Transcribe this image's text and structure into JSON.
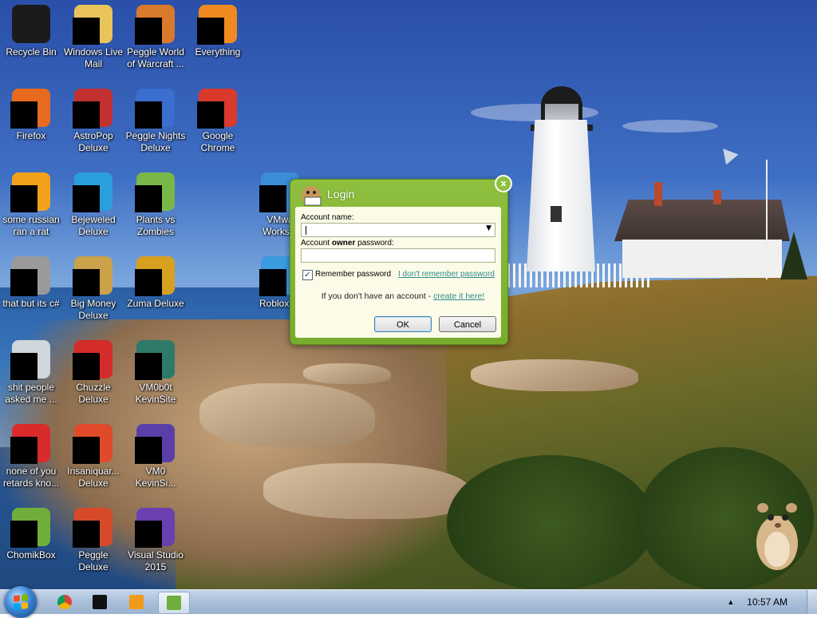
{
  "desktop": {
    "icons": [
      {
        "label": "Recycle Bin",
        "icon": "recycle-bin-icon",
        "color": "#1b1b1b",
        "masked": false
      },
      {
        "label": "Windows Live\nMail",
        "icon": "windows-live-mail-icon",
        "color": "#e8c45a",
        "masked": true
      },
      {
        "label": "Peggle World\nof Warcraft ...",
        "icon": "peggle-wow-icon",
        "color": "#d9792b",
        "masked": true
      },
      {
        "label": "Everything",
        "icon": "everything-search-icon",
        "color": "#f08a20",
        "masked": true
      },
      {
        "label": "Firefox",
        "icon": "firefox-icon",
        "color": "#e86a1f",
        "masked": true
      },
      {
        "label": "AstroPop\nDeluxe",
        "icon": "astropop-icon",
        "color": "#c23030",
        "masked": true
      },
      {
        "label": "Peggle Nights\nDeluxe",
        "icon": "peggle-nights-icon",
        "color": "#3a6fd0",
        "masked": true
      },
      {
        "label": "Google\nChrome",
        "icon": "chrome-icon",
        "color": "#d93a2b",
        "masked": true
      },
      {
        "label": "some russian\nran a rat",
        "icon": "app-icon",
        "color": "#f2a21a",
        "masked": true
      },
      {
        "label": "Bejeweled\nDeluxe",
        "icon": "bejeweled-icon",
        "color": "#2b9fdc",
        "masked": true
      },
      {
        "label": "Plants vs\nZombies",
        "icon": "plants-vs-zombies-icon",
        "color": "#79b848",
        "masked": true
      },
      {
        "label": "VMwa\nWorksta",
        "icon": "vmware-icon",
        "color": "#3b8fd8",
        "masked": true
      },
      {
        "label": "that but its c#",
        "icon": "shortcut-icon",
        "color": "#9a9a9a",
        "masked": true
      },
      {
        "label": "Big Money\nDeluxe",
        "icon": "big-money-icon",
        "color": "#c9a24a",
        "masked": true
      },
      {
        "label": "Zuma Deluxe",
        "icon": "zuma-icon",
        "color": "#d7a020",
        "masked": true
      },
      {
        "label": "Roblox St",
        "icon": "roblox-studio-icon",
        "color": "#3a9be0",
        "masked": true
      },
      {
        "label": "shit people\nasked me ...",
        "icon": "folder-icon",
        "color": "#cfd6dc",
        "masked": true
      },
      {
        "label": "Chuzzle\nDeluxe",
        "icon": "chuzzle-icon",
        "color": "#d42b2b",
        "masked": true
      },
      {
        "label": "VM0b0t\nKevinSite",
        "icon": "vm-shortcut-icon",
        "color": "#2d7a6a",
        "masked": true
      },
      {
        "label": "none of you\nretards kno...",
        "icon": "opera-icon",
        "color": "#d92b2b",
        "masked": true
      },
      {
        "label": "Insaniquar...\nDeluxe",
        "icon": "insaniquarium-icon",
        "color": "#e04a2a",
        "masked": true
      },
      {
        "label": "VM0\nKevinSi...",
        "icon": "vm-shortcut-icon",
        "color": "#5a3fa8",
        "masked": true
      },
      {
        "label": "ChomikBox",
        "icon": "chomikbox-icon",
        "color": "#6fae3a",
        "masked": true
      },
      {
        "label": "Peggle Deluxe",
        "icon": "peggle-icon",
        "color": "#d64a2a",
        "masked": true
      },
      {
        "label": "Visual Studio\n2015",
        "icon": "visual-studio-icon",
        "color": "#6a3fb0",
        "masked": true
      }
    ]
  },
  "login": {
    "title": "Login",
    "close_glyph": "x",
    "account_name_label": "Account name:",
    "account_name_value": "",
    "password_label_prefix": "Account ",
    "password_label_bold": "owner",
    "password_label_suffix": " password:",
    "password_value": "",
    "remember_label": "Remember password",
    "remember_checked": true,
    "forgot_link": "I don't remember password",
    "signup_text": "If you don't have an account - ",
    "signup_link": "create it here!",
    "ok_label": "OK",
    "cancel_label": "Cancel",
    "accent_color": "#80b432"
  },
  "taskbar": {
    "pinned": [
      {
        "icon": "chrome-icon",
        "active": false
      },
      {
        "icon": "black-window-icon",
        "active": false
      },
      {
        "icon": "media-player-icon",
        "active": false
      },
      {
        "icon": "chomikbox-icon",
        "active": true
      }
    ],
    "tray_arrow": "▲",
    "clock": "10:57 AM"
  }
}
